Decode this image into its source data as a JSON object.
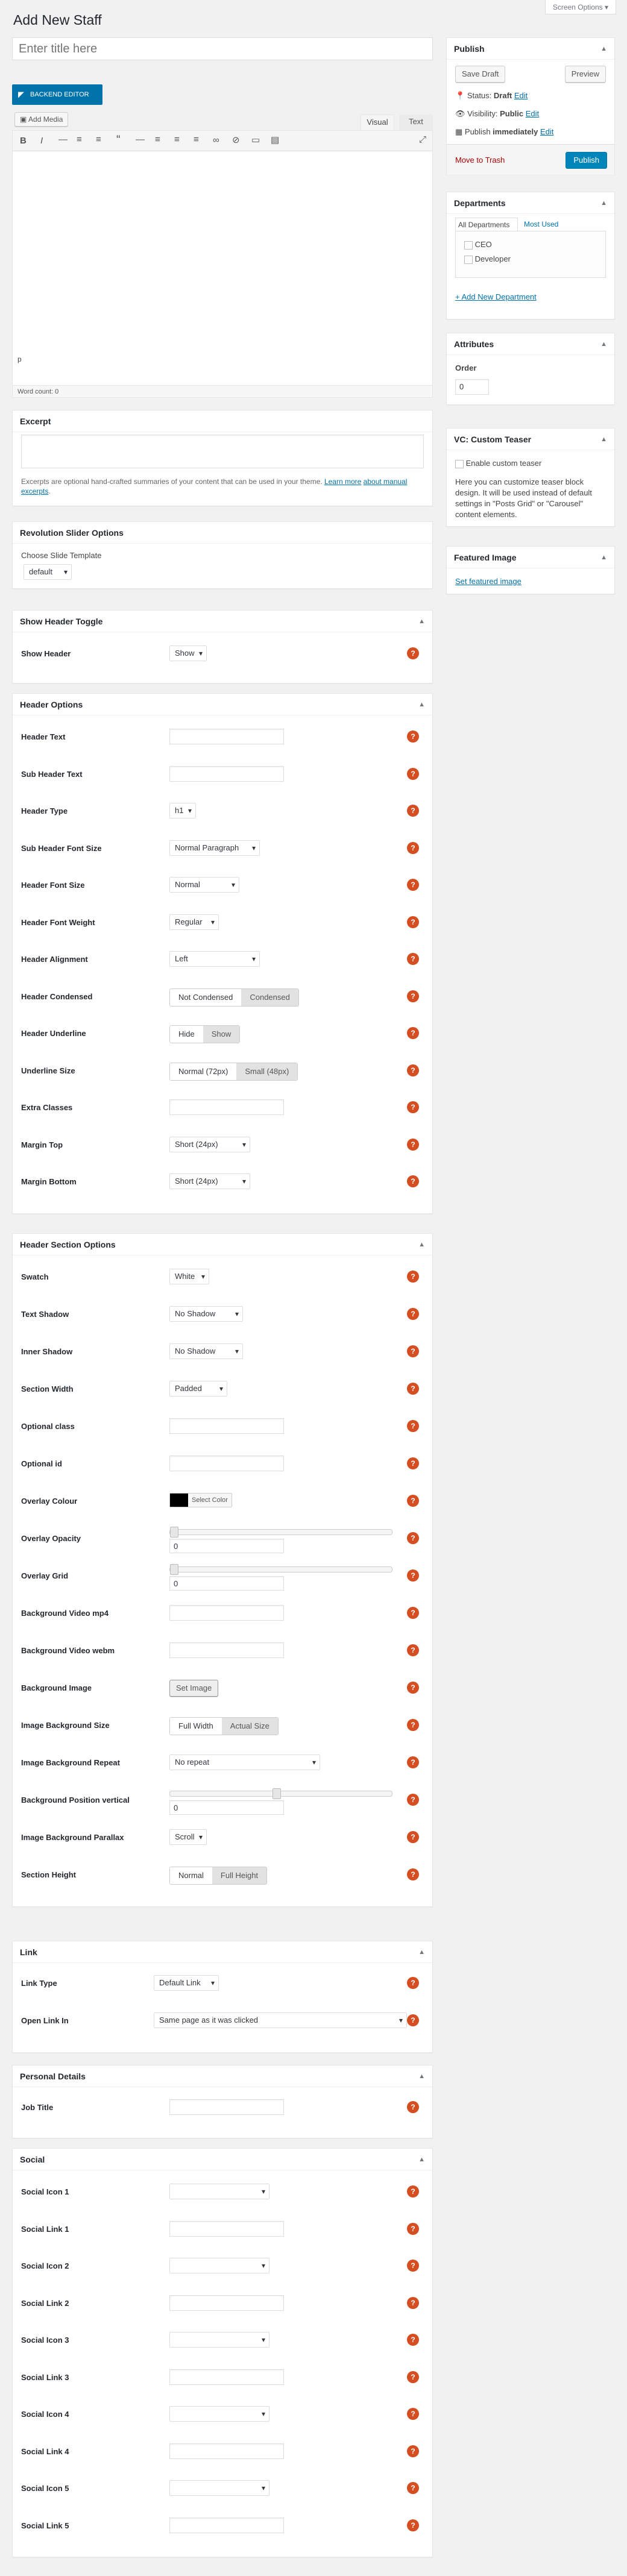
{
  "header": {
    "title": "Add New Staff",
    "screen_options": "Screen Options ▾"
  },
  "editor": {
    "title_placeholder": "Enter title here",
    "backend_editor": "BACKEND EDITOR",
    "add_media": "Add Media",
    "tab_visual": "Visual",
    "tab_text": "Text",
    "path": "p",
    "word_count": "Word count: 0"
  },
  "excerpt": {
    "title": "Excerpt",
    "help_text": "Excerpts are optional hand-crafted summaries of your content that can be used in your theme.",
    "help_link_1": "Learn more",
    "help_link_2": "about manual excerpts",
    "help_end": "."
  },
  "revslider": {
    "title": "Revolution Slider Options",
    "choose_label": "Choose Slide Template",
    "value": "default"
  },
  "show_header": {
    "title": "Show Header Toggle",
    "rows": [
      {
        "label": "Show Header",
        "value": "Show"
      }
    ]
  },
  "header_options": {
    "title": "Header Options",
    "rows": [
      {
        "label": "Header Text"
      },
      {
        "label": "Sub Header Text"
      },
      {
        "label": "Header Type",
        "value": "h1"
      },
      {
        "label": "Sub Header Font Size",
        "value": "Normal Paragraph"
      },
      {
        "label": "Header Font Size",
        "value": "Normal"
      },
      {
        "label": "Header Font Weight",
        "value": "Regular"
      },
      {
        "label": "Header Alignment",
        "value": "Left"
      },
      {
        "label": "Header Condensed",
        "seg": [
          "Not Condensed",
          "Condensed"
        ]
      },
      {
        "label": "Header Underline",
        "seg": [
          "Hide",
          "Show"
        ]
      },
      {
        "label": "Underline Size",
        "seg": [
          "Normal (72px)",
          "Small (48px)"
        ]
      },
      {
        "label": "Extra Classes"
      },
      {
        "label": "Margin Top",
        "value": "Short (24px)"
      },
      {
        "label": "Margin Bottom",
        "value": "Short (24px)"
      }
    ]
  },
  "header_section": {
    "title": "Header Section Options",
    "rows": [
      {
        "label": "Swatch",
        "value": "White"
      },
      {
        "label": "Text Shadow",
        "value": "No Shadow"
      },
      {
        "label": "Inner Shadow",
        "value": "No Shadow"
      },
      {
        "label": "Section Width",
        "value": "Padded"
      },
      {
        "label": "Optional class"
      },
      {
        "label": "Optional id"
      },
      {
        "label": "Overlay Colour",
        "button": "Select Color"
      },
      {
        "label": "Overlay Opacity",
        "num": "0"
      },
      {
        "label": "Overlay Grid",
        "num": "0"
      },
      {
        "label": "Background Video mp4"
      },
      {
        "label": "Background Video webm"
      },
      {
        "label": "Background Image",
        "button": "Set Image"
      },
      {
        "label": "Image Background Size",
        "seg": [
          "Full Width",
          "Actual Size"
        ]
      },
      {
        "label": "Image Background Repeat",
        "value": "No repeat"
      },
      {
        "label": "Background Position vertical",
        "num": "0"
      },
      {
        "label": "Image Background Parallax",
        "value": "Scroll"
      },
      {
        "label": "Section Height",
        "seg": [
          "Normal",
          "Full Height"
        ]
      }
    ]
  },
  "link_box": {
    "title": "Link",
    "rows": [
      {
        "label": "Link Type",
        "value": "Default Link"
      },
      {
        "label": "Open Link In",
        "value": "Same page as it was clicked"
      }
    ]
  },
  "personal": {
    "title": "Personal Details",
    "rows": [
      {
        "label": "Job Title"
      }
    ]
  },
  "social": {
    "title": "Social",
    "rows": [
      {
        "label": "Social Icon 1"
      },
      {
        "label": "Social Link 1"
      },
      {
        "label": "Social Icon 2"
      },
      {
        "label": "Social Link 2"
      },
      {
        "label": "Social Icon 3"
      },
      {
        "label": "Social Link 3"
      },
      {
        "label": "Social Icon 4"
      },
      {
        "label": "Social Link 4"
      },
      {
        "label": "Social Icon 5"
      },
      {
        "label": "Social Link 5"
      }
    ]
  },
  "publish": {
    "title": "Publish",
    "save_draft": "Save Draft",
    "preview": "Preview",
    "status": "Status:",
    "status_value": "Draft",
    "visibility": "Visibility:",
    "visibility_value": "Public",
    "publish_label": "Publish",
    "publish_when": "immediately",
    "edit": "Edit",
    "trash": "Move to Trash",
    "publish_btn": "Publish"
  },
  "departments": {
    "title": "Departments",
    "tab_all": "All Departments",
    "tab_used": "Most Used",
    "items": [
      "CEO",
      "Developer"
    ],
    "add": "+ Add New Department"
  },
  "attributes": {
    "title": "Attributes",
    "order_label": "Order",
    "order_value": "0"
  },
  "teaser": {
    "title": "VC: Custom Teaser",
    "checkbox": "Enable custom teaser",
    "desc": "Here you can customize teaser block design. It will be used instead of default settings in \"Posts Grid\" or \"Carousel\" content elements."
  },
  "featured": {
    "title": "Featured Image",
    "link": "Set featured image"
  },
  "help_glyph": "?",
  "colors": {
    "accent": "#0073aa",
    "publish": "#0085ba",
    "help": "#d54e21",
    "trash": "#a00"
  }
}
